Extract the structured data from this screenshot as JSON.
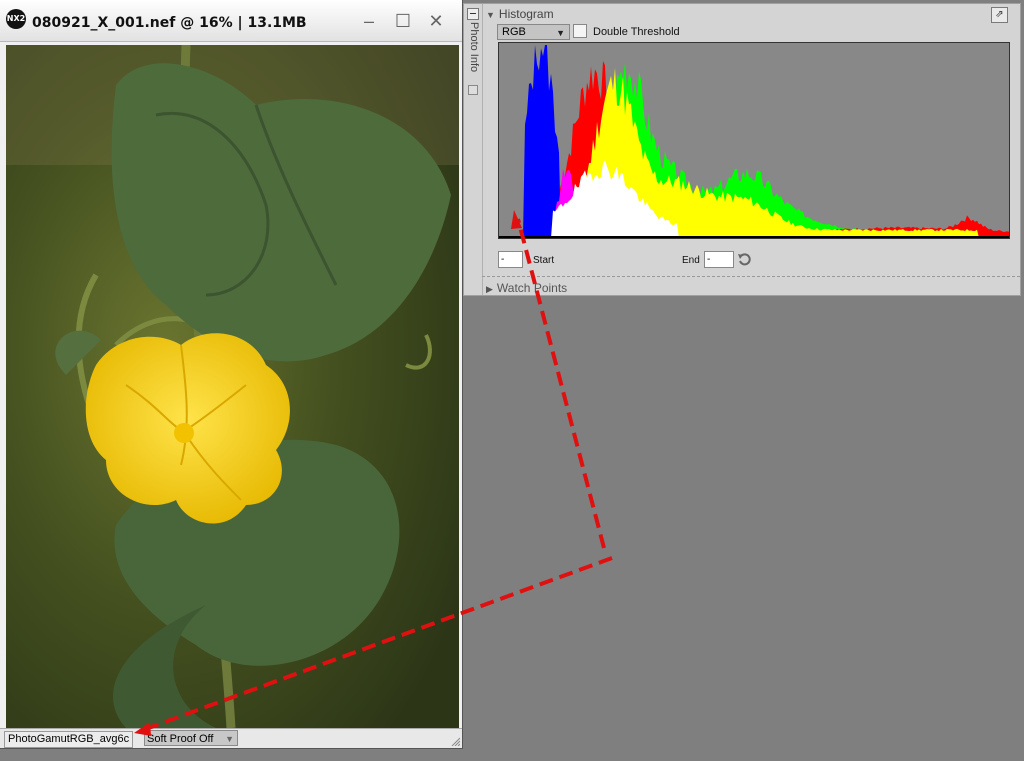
{
  "window": {
    "app_logo": "NX2",
    "title": "080921_X_001.nef @ 16% | 13.1MB",
    "controls": {
      "minimize": "–",
      "maximize": "☐",
      "close": "✕"
    }
  },
  "statusbar": {
    "profile": "PhotoGamutRGB_avg6c",
    "soft_proof": "Soft Proof Off"
  },
  "palette": {
    "side_tab": "Photo Info",
    "histogram": {
      "title": "Histogram",
      "channel": "RGB",
      "double_threshold_label": "Double Threshold",
      "double_threshold_checked": false,
      "start_label": "Start",
      "start_value": "-",
      "end_label": "End",
      "end_value": "-",
      "colors": {
        "blue": "#0000ff",
        "red": "#ff0000",
        "green": "#00ff00",
        "yellow": "#ffff00",
        "magenta": "#ff00ff",
        "white": "#ffffff"
      }
    },
    "watch_points": {
      "title": "Watch Points"
    }
  },
  "annotation": {
    "arrow_color": "#e01010"
  }
}
